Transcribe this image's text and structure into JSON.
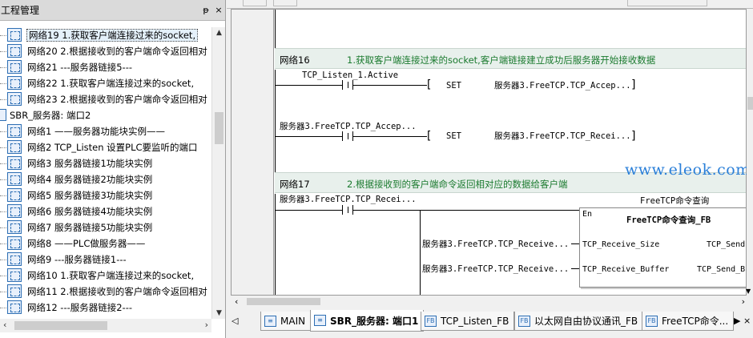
{
  "project_panel": {
    "title": "工程管理",
    "pin_glyph": "ᵽ",
    "close_glyph": "×",
    "items": [
      {
        "label": "网络19 1.获取客户端连接过来的socket,",
        "type": "network",
        "selected": true
      },
      {
        "label": "网络20 2.根据接收到的客户端命令返回相对",
        "type": "network"
      },
      {
        "label": "网络21 ---服务器链接5---",
        "type": "network"
      },
      {
        "label": "网络22 1.获取客户端连接过来的socket,",
        "type": "network"
      },
      {
        "label": "网络23 2.根据接收到的客户端命令返回相对",
        "type": "network"
      },
      {
        "label": "SBR_服务器: 端口2",
        "type": "sbr"
      },
      {
        "label": "网络1 ——服务器功能块实例——",
        "type": "network"
      },
      {
        "label": "网络2 TCP_Listen  设置PLC要监听的端口",
        "type": "network"
      },
      {
        "label": "网络3 服务器链接1功能块实例",
        "type": "network"
      },
      {
        "label": "网络4 服务器链接2功能块实例",
        "type": "network"
      },
      {
        "label": "网络5 服务器链接3功能块实例",
        "type": "network"
      },
      {
        "label": "网络6 服务器链接4功能块实例",
        "type": "network"
      },
      {
        "label": "网络7 服务器链接5功能块实例",
        "type": "network"
      },
      {
        "label": "网络8 ——PLC做服务器——",
        "type": "network"
      },
      {
        "label": "网络9 ---服务器链接1---",
        "type": "network"
      },
      {
        "label": "网络10 1.获取客户端连接过来的socket,",
        "type": "network"
      },
      {
        "label": "网络11 2.根据接收到的客户端命令返回相对",
        "type": "network"
      },
      {
        "label": "网络12 ---服务器链接2---",
        "type": "network"
      }
    ]
  },
  "editor": {
    "network16": {
      "name": "网络16",
      "comment": "1.获取客户端连接过来的socket,客户端链接建立成功后服务器开始接收数据",
      "rung1_contact": "TCP_Listen_1.Active",
      "rung1_instr": "SET",
      "rung1_operand": "服务器3.FreeTCP.TCP_Accep...",
      "rung2_contact": "服务器3.FreeTCP.TCP_Accep...",
      "rung2_instr": "SET",
      "rung2_operand": "服务器3.FreeTCP.TCP_Recei..."
    },
    "network17": {
      "name": "网络17",
      "comment": "2.根据接收到的客户端命令返回相对应的数据给客户端",
      "contact": "服务器3.FreeTCP.TCP_Recei...",
      "fb_instance": "FreeTCP命令查询",
      "fb_title": "FreeTCP命令查询_FB",
      "fb_en": "En",
      "input1_var": "服务器3.FreeTCP.TCP_Receive...",
      "input1_pin": "TCP_Receive_Size",
      "input2_var": "服务器3.FreeTCP.TCP_Receive...",
      "input2_pin": "TCP_Receive_Buffer",
      "output1_pin": "TCP_Send",
      "output2_pin": "TCP_Send_B"
    },
    "watermark": "www.eleok.com"
  },
  "tabs": [
    {
      "label": "MAIN",
      "icon": "ladder-icon",
      "active": false
    },
    {
      "label": "SBR_服务器: 端口1",
      "icon": "ladder-icon",
      "active": true
    },
    {
      "label": "TCP_Listen_FB",
      "icon": "fb-icon",
      "active": false
    },
    {
      "label": "以太网自由协议通讯_FB",
      "icon": "fb-icon",
      "active": false
    },
    {
      "label": "FreeTCP命令...",
      "icon": "fb-icon",
      "active": false
    }
  ]
}
